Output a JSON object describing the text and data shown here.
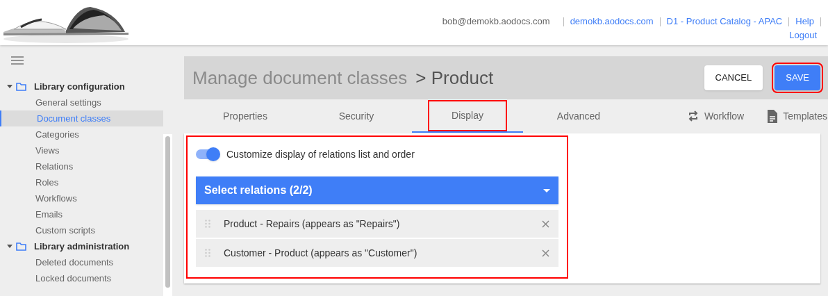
{
  "header": {
    "user": "bob@demokb.aodocs.com",
    "links": [
      "demokb.aodocs.com",
      "D1 - Product Catalog - APAC",
      "Help",
      "Logout"
    ]
  },
  "sidebar": {
    "groups": [
      {
        "label": "Library configuration",
        "expanded": true,
        "children": [
          {
            "label": "General settings",
            "selected": false
          },
          {
            "label": "Document classes",
            "selected": true
          },
          {
            "label": "Categories",
            "selected": false
          },
          {
            "label": "Views",
            "selected": false
          },
          {
            "label": "Relations",
            "selected": false
          },
          {
            "label": "Roles",
            "selected": false
          },
          {
            "label": "Workflows",
            "selected": false
          },
          {
            "label": "Emails",
            "selected": false
          },
          {
            "label": "Custom scripts",
            "selected": false
          }
        ]
      },
      {
        "label": "Library administration",
        "expanded": true,
        "children": [
          {
            "label": "Deleted documents",
            "selected": false
          },
          {
            "label": "Locked documents",
            "selected": false
          }
        ]
      }
    ]
  },
  "page": {
    "breadcrumb": "Manage document classes",
    "title": "> Product",
    "buttons": [
      {
        "label": "CANCEL",
        "kind": "secondary",
        "highlighted": false
      },
      {
        "label": "SAVE",
        "kind": "primary",
        "highlighted": true
      }
    ]
  },
  "tabs": [
    {
      "label": "Properties",
      "selected": false,
      "highlighted": false
    },
    {
      "label": "Security",
      "selected": false,
      "highlighted": false
    },
    {
      "label": "Display",
      "selected": true,
      "highlighted": true
    },
    {
      "label": "Advanced",
      "selected": false,
      "highlighted": false
    }
  ],
  "tab_actions": [
    {
      "label": "Workflow",
      "kind": "workflow"
    },
    {
      "label": "Templates",
      "kind": "templates"
    }
  ],
  "display": {
    "highlighted": true,
    "toggle": {
      "label": "Customize display of relations list and order",
      "on": true
    },
    "select": {
      "label": "Select relations (2/2)"
    },
    "relations": [
      "Product - Repairs (appears as \"Repairs\")",
      "Customer - Product (appears as \"Customer\")"
    ]
  }
}
